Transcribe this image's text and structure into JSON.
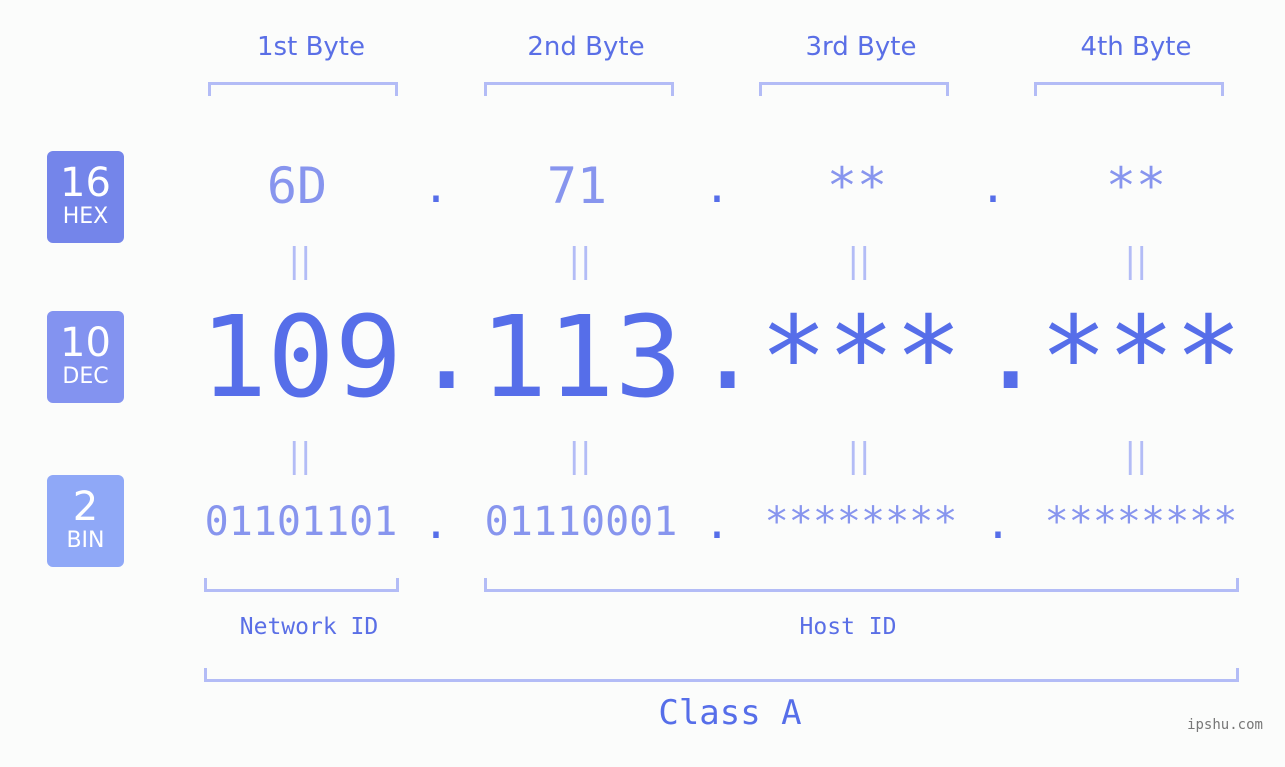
{
  "bytes": [
    {
      "label": "1st Byte",
      "hex": "6D",
      "dec": "109",
      "bin": "01101101"
    },
    {
      "label": "2nd Byte",
      "hex": "71",
      "dec": "113",
      "bin": "01110001"
    },
    {
      "label": "3rd Byte",
      "hex": "**",
      "dec": "***",
      "bin": "********"
    },
    {
      "label": "4th Byte",
      "hex": "**",
      "dec": "***",
      "bin": "********"
    }
  ],
  "bases": {
    "hex": {
      "num": "16",
      "label": "HEX",
      "color": "#7485ea"
    },
    "dec": {
      "num": "10",
      "label": "DEC",
      "color": "#8393f0"
    },
    "bin": {
      "num": "2",
      "label": "BIN",
      "color": "#8fa8f7"
    }
  },
  "separator": ".",
  "equals": "||",
  "network_id_label": "Network ID",
  "host_id_label": "Host ID",
  "class_label": "Class A",
  "watermark": "ipshu.com",
  "colors": {
    "accent": "#566ee9",
    "light_accent": "#8795ee",
    "bracket": "#b3bcf6",
    "background": "#fbfcfb"
  }
}
